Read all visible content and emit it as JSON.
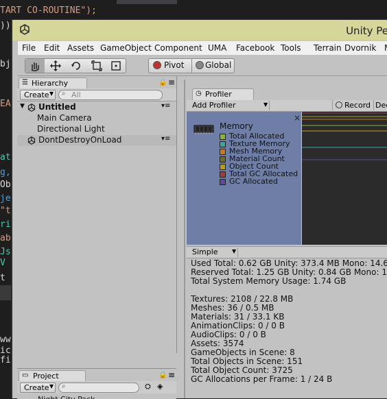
{
  "editor": {
    "lines": [
      {
        "text": "TART CO-ROUTINE\");",
        "color": "#d69d85"
      },
      {
        "text": "))",
        "color": "#dcdcdc"
      },
      {
        "text": "bj",
        "color": "#dcdcdc"
      },
      {
        "text": "EA",
        "color": "#d69d85"
      },
      {
        "text": "at",
        "color": "#4ec9b0"
      },
      {
        "text": "g,",
        "color": "#569cd6"
      },
      {
        "text": "Ob",
        "color": "#dcdcdc"
      },
      {
        "text": "je",
        "color": "#569cd6"
      },
      {
        "text": "\"t",
        "color": "#d69d85"
      },
      {
        "text": "ri",
        "color": "#4ec9b0"
      },
      {
        "text": "ab",
        "color": "#d69d85"
      },
      {
        "text": "Js",
        "color": "#4ec9b0"
      },
      {
        "text": "V",
        "color": "#4ec9b0"
      },
      {
        "text": "t",
        "color": "#dcdcdc"
      },
      {
        "text": "ww",
        "color": "#dcdcdc"
      },
      {
        "text": "ic",
        "color": "#dcdcdc"
      },
      {
        "text": "fi",
        "color": "#dcdcdc"
      }
    ]
  },
  "window": {
    "title": "Unity Pe"
  },
  "menu": [
    "File",
    "Edit",
    "Assets",
    "GameObject",
    "Component",
    "UMA",
    "Facebook",
    "Tools",
    "Terrain",
    "Dvornik",
    "M"
  ],
  "toolbar": {
    "pivot": "Pivot",
    "global": "Global"
  },
  "hierarchy": {
    "tab": "Hierarchy",
    "create": "Create",
    "search_placeholder": "All",
    "scene": "Untitled",
    "items": [
      "Main Camera",
      "Directional Light"
    ],
    "ddol": "DontDestroyOnLoad"
  },
  "profiler": {
    "tab": "Profiler",
    "add": "Add Profiler",
    "record": "Record",
    "deep": "Dee",
    "memory_title": "Memory",
    "legend": [
      {
        "label": "Total Allocated",
        "color": "#8fb03b"
      },
      {
        "label": "Texture Memory",
        "color": "#3aa7a7"
      },
      {
        "label": "Mesh Memory",
        "color": "#c57a2a"
      },
      {
        "label": "Material Count",
        "color": "#6a6f2a"
      },
      {
        "label": "Object Count",
        "color": "#b59b22"
      },
      {
        "label": "Total GC Allocated",
        "color": "#a23c3c"
      },
      {
        "label": "GC Allocated",
        "color": "#5a4f8f"
      }
    ],
    "mode": "Simple",
    "stats": [
      "Used Total: 0.62 GB   Unity: 373.4 MB   Mono: 14.6",
      "Reserved Total: 1.25 GB   Unity: 0.84 GB   Mono: 1",
      "Total System Memory Usage: 1.74 GB",
      "",
      "Textures: 2108 / 22.8 MB",
      "Meshes: 36 / 0.5 MB",
      "Materials: 31 / 33.1 KB",
      "AnimationClips: 0 / 0 B",
      "AudioClips: 0 / 0 B",
      "Assets: 3574",
      "GameObjects in Scene: 8",
      "Total Objects in Scene: 151",
      "Total Object Count: 3725",
      "GC Allocations per Frame: 1 / 24 B"
    ]
  },
  "project": {
    "tab": "Project",
    "create": "Create",
    "item": "Night City Pack"
  }
}
